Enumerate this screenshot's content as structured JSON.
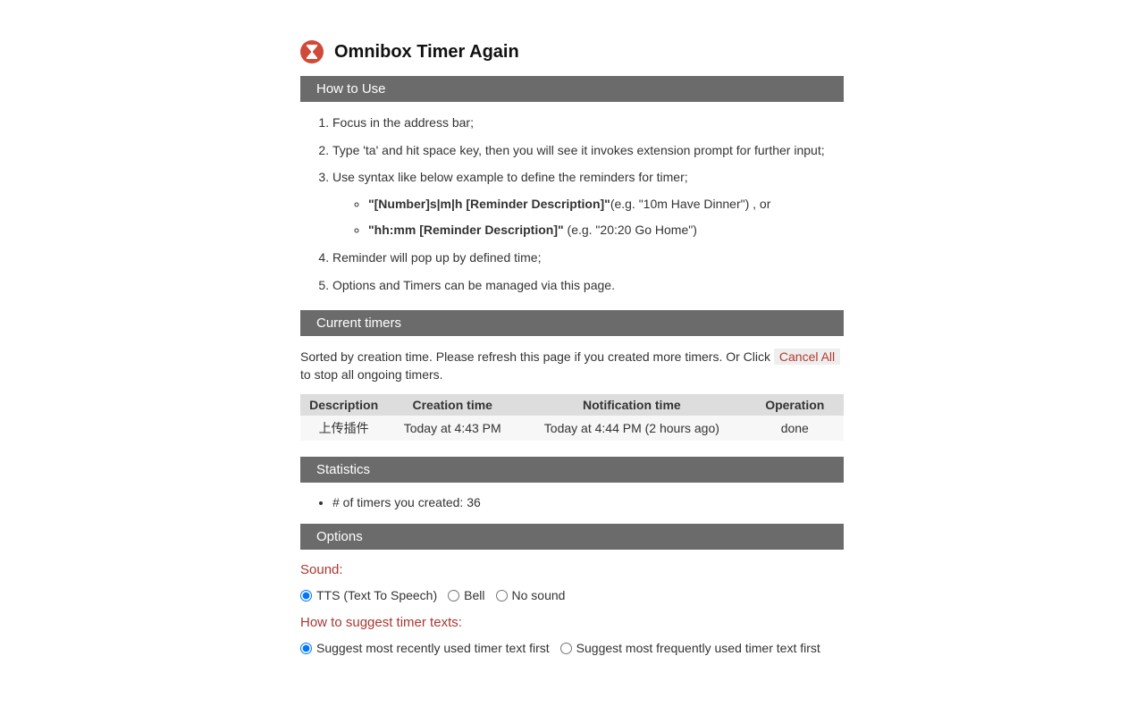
{
  "title": "Omnibox Timer Again",
  "sections": {
    "howto": {
      "header": "How to Use",
      "steps": [
        "Focus in the address bar;",
        "Type 'ta' and hit space key, then you will see it invokes extension prompt for further input;",
        "Use syntax like below example to define the reminders for timer;",
        "Reminder will pop up by defined time;",
        "Options and Timers can be managed via this page."
      ],
      "syntax1_bold": "\"[Number]s|m|h [Reminder Description]\"",
      "syntax1_rest": "(e.g. \"10m Have Dinner\") , or",
      "syntax2_bold": "\"hh:mm [Reminder Description]\"",
      "syntax2_rest": " (e.g. \"20:20 Go Home\")"
    },
    "current": {
      "header": "Current timers",
      "note_before": "Sorted by creation time. Please refresh this page if you created more timers. Or Click ",
      "cancel_label": "Cancel All",
      "note_after": " to stop all ongoing timers.",
      "columns": [
        "Description",
        "Creation time",
        "Notification time",
        "Operation"
      ],
      "rows": [
        {
          "desc": "上传插件",
          "created": "Today at 4:43 PM",
          "notify": "Today at 4:44 PM (2 hours ago)",
          "op": "done"
        }
      ]
    },
    "stats": {
      "header": "Statistics",
      "line_label": "# of timers you created: ",
      "count": "36"
    },
    "options": {
      "header": "Options",
      "sound_label": "Sound:",
      "sound_opts": [
        "TTS (Text To Speech)",
        "Bell",
        "No sound"
      ],
      "suggest_label": "How to suggest timer texts:",
      "suggest_opts": [
        "Suggest most recently used timer text first",
        "Suggest most frequently used timer text first"
      ]
    }
  }
}
